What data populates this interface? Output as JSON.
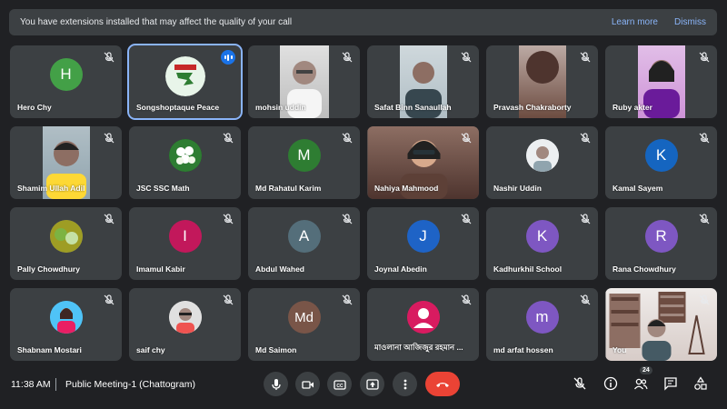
{
  "banner": {
    "message": "You have extensions installed that may affect the quality of your call",
    "learn_more": "Learn more",
    "dismiss": "Dismiss"
  },
  "participants": [
    {
      "name": "Hero Chy",
      "initial": "H",
      "color": "#43a047"
    },
    {
      "name": "Songshoptaque Peace",
      "speaking": true
    },
    {
      "name": "mohsin uddin"
    },
    {
      "name": "Safat Binn Sanaullah"
    },
    {
      "name": "Pravash Chakraborty"
    },
    {
      "name": "Ruby akter"
    },
    {
      "name": "Shamim Ullah Adil"
    },
    {
      "name": "JSC SSC Math"
    },
    {
      "name": "Md Rahatul Karim",
      "initial": "M",
      "color": "#2e7d32"
    },
    {
      "name": "Nahiya Mahmood"
    },
    {
      "name": "Nashir Uddin"
    },
    {
      "name": "Kamal Sayem",
      "initial": "K",
      "color": "#1565c0"
    },
    {
      "name": "Pally Chowdhury"
    },
    {
      "name": "Imamul Kabir",
      "initial": "I",
      "color": "#c2185b"
    },
    {
      "name": "Abdul Wahed",
      "initial": "A",
      "color": "#546e7a"
    },
    {
      "name": "Joynal Abedin",
      "initial": "J",
      "color": "#1e63c6"
    },
    {
      "name": "Kadhurkhil School",
      "initial": "K",
      "color": "#7e57c2"
    },
    {
      "name": "Rana Chowdhury",
      "initial": "R",
      "color": "#7e57c2"
    },
    {
      "name": "Shabnam Mostari"
    },
    {
      "name": "saif chy"
    },
    {
      "name": "Md Saimon",
      "initial": "Md",
      "color": "#795548"
    },
    {
      "name": "মাওলানা আজিজুর রহমান ..."
    },
    {
      "name": "md arfat hossen",
      "initial": "m",
      "color": "#7e57c2"
    },
    {
      "name": "You"
    }
  ],
  "footer": {
    "time": "11:38 AM",
    "meeting_name": "Public Meeting-1 (Chattogram)",
    "participant_count": "24"
  },
  "colors": {
    "background": "#202124",
    "tile": "#3c4043",
    "accent": "#8ab4f8",
    "end_call": "#ea4335"
  }
}
